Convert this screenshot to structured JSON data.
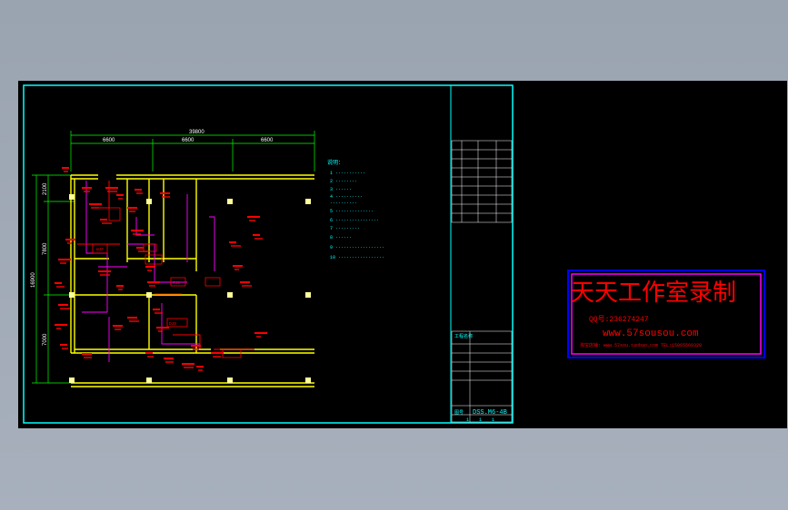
{
  "drawing": {
    "dimensions": {
      "overall": "39800",
      "top_segments": [
        "6600",
        "6600",
        "6600"
      ],
      "left_segments": [
        "2100",
        "7800",
        "7000"
      ],
      "left_total": "16900"
    },
    "room_labels": [
      "WJF",
      "FJD",
      "DJD"
    ],
    "notes": {
      "heading": "说明：",
      "items": [
        "1  ···········",
        "2  ········",
        "3  ······",
        "4  ··········",
        "   ··········",
        "5  ··············",
        "6  ················",
        "7  ·········",
        "8  ······",
        "9  ··················",
        "10 ·················"
      ]
    },
    "title_block": {
      "project_label": "工程名称",
      "drawing_label": "图号",
      "drawing_number": "DSS.M6-4B",
      "bottom_marks": [
        "1",
        "1",
        "1"
      ]
    },
    "watermark": {
      "title": "天天工作室录制",
      "qq": "QQ号:236274247",
      "url": "www.57sousou.com",
      "contact": "淘宝店铺: www.57sou.taobao.com TEL:15065560320"
    }
  },
  "colors": {
    "frame": "#00ffff",
    "walls": "#ffff00",
    "annotations": "#ff0000",
    "pipes": "#ff00ff",
    "notes": "#00ffff",
    "watermark_border": "#0000ff",
    "watermark_text": "#ff0000"
  }
}
